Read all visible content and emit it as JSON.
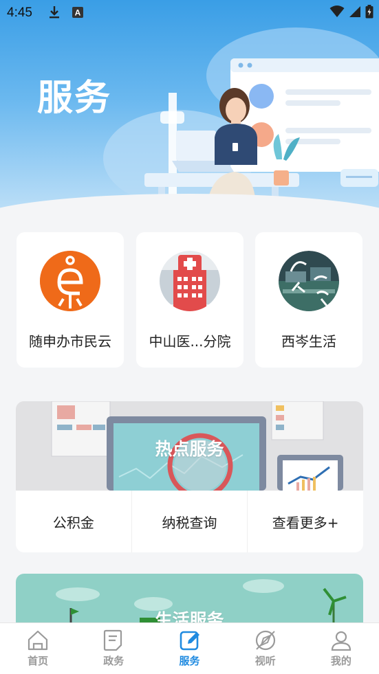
{
  "status_bar": {
    "time": "4:45",
    "a_badge": "A"
  },
  "header": {
    "title": "服务"
  },
  "quick_apps": [
    {
      "label": "随申办市民云",
      "color": "#ef6a19"
    },
    {
      "label": "中山医...分院",
      "color": "#e24b4b"
    },
    {
      "label": "西岑生活"
    }
  ],
  "hot_services": {
    "title": "热点服务",
    "items": [
      "公积金",
      "纳税查询",
      "查看更多+"
    ]
  },
  "life_services": {
    "title": "生活服务"
  },
  "bottom_nav": {
    "items": [
      {
        "label": "首页",
        "icon": "home-icon"
      },
      {
        "label": "政务",
        "icon": "document-icon"
      },
      {
        "label": "服务",
        "icon": "edit-icon"
      },
      {
        "label": "视听",
        "icon": "compass-icon"
      },
      {
        "label": "我的",
        "icon": "user-icon"
      }
    ],
    "active_color": "#1f8ae0",
    "inactive_color": "#9a9a9a"
  }
}
